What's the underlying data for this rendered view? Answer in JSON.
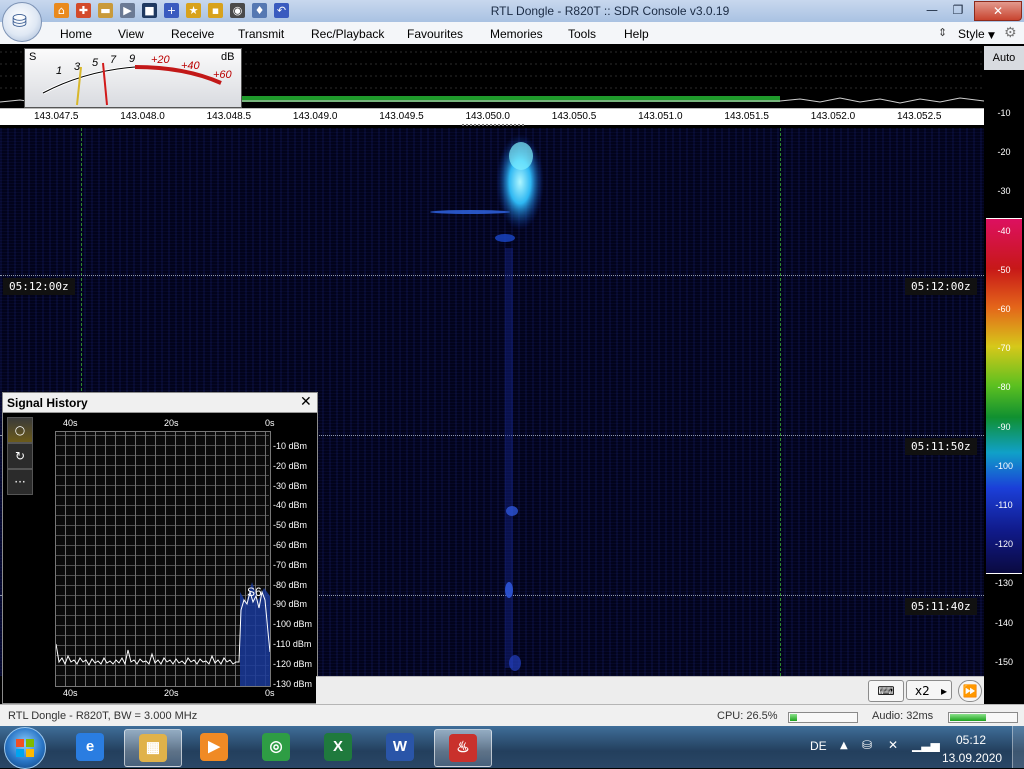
{
  "window": {
    "title": "RTL Dongle - R820T :: SDR Console v3.0.19"
  },
  "titlebar": {
    "minimize": "—",
    "maximize": "❐",
    "close": "✕"
  },
  "quick_access": [
    {
      "icon": "home-icon",
      "glyph": "⌂",
      "color": "#e98a1e"
    },
    {
      "icon": "help-lifebuoy-icon",
      "glyph": "✚",
      "color": "#d34a2a"
    },
    {
      "icon": "folder-icon",
      "glyph": "▬",
      "color": "#c99a3a"
    },
    {
      "icon": "play-icon",
      "glyph": "▶",
      "color": "#6b7a94"
    },
    {
      "icon": "stop-icon",
      "glyph": "■",
      "color": "#1f3960"
    },
    {
      "icon": "add-icon",
      "glyph": "+",
      "color": "#3a5bbf"
    },
    {
      "icon": "star-icon",
      "glyph": "★",
      "color": "#d8a21c"
    },
    {
      "icon": "lock-icon",
      "glyph": "▪",
      "color": "#d8a21c"
    },
    {
      "icon": "camera-icon",
      "glyph": "◉",
      "color": "#4a4a4a"
    },
    {
      "icon": "drop-icon",
      "glyph": "♦",
      "color": "#5578b2"
    },
    {
      "icon": "undo-icon",
      "glyph": "↶",
      "color": "#3a5bbf"
    }
  ],
  "menu": [
    "Home",
    "View",
    "Receive",
    "Transmit",
    "Rec/Playback",
    "Favourites",
    "Memories",
    "Tools",
    "Help"
  ],
  "style_label": "Style",
  "smeter": {
    "s_label": "S",
    "db_label": "dB",
    "s_ticks": [
      "1",
      "3",
      "5",
      "7",
      "9"
    ],
    "db_ticks": [
      "+20",
      "+40",
      "+60"
    ]
  },
  "freq_ticks": [
    "143.047.5",
    "143.048.0",
    "143.048.5",
    "143.049.0",
    "143.049.5",
    "143.050.0",
    "143.050.5",
    "143.051.0",
    "143.051.5",
    "143.052.0",
    "143.052.5"
  ],
  "time_labels": [
    "05:12:00z",
    "05:11:50z",
    "05:11:40z"
  ],
  "right_scale": {
    "auto": "Auto",
    "ticks": [
      "-10",
      "-20",
      "-30",
      "-40",
      "-50",
      "-60",
      "-70",
      "-80",
      "-90",
      "-100",
      "-110",
      "-120",
      "-130",
      "-140",
      "-150"
    ]
  },
  "signal_history": {
    "title": "Signal History",
    "close": "✕",
    "buttons": [
      "○",
      "↻",
      "···"
    ],
    "x_ticks": [
      "40s",
      "20s",
      "0s"
    ],
    "y_ticks": [
      "-10 dBm",
      "-20 dBm",
      "-30 dBm",
      "-40 dBm",
      "-50 dBm",
      "-60 dBm",
      "-70 dBm",
      "-80 dBm",
      "-90 dBm",
      "-100 dBm",
      "-110 dBm",
      "-120 dBm",
      "-130 dBm"
    ],
    "s_reading": "S6"
  },
  "controls": {
    "keyboard": "⌨",
    "zoom": "x2",
    "arrow": "▸",
    "skip": "⏩"
  },
  "status": {
    "device": "RTL Dongle - R820T, BW = 3.000 MHz",
    "cpu": "CPU: 26.5%",
    "cpu_level": 0.1,
    "audio": "Audio: 32ms",
    "audio_level": 0.55
  },
  "taskbar": {
    "apps": [
      {
        "name": "internet-explorer",
        "glyph": "e",
        "color": "#2a7de1"
      },
      {
        "name": "file-explorer",
        "glyph": "▦",
        "color": "#e0b24a"
      },
      {
        "name": "media-player",
        "glyph": "▶",
        "color": "#f08a24"
      },
      {
        "name": "chrome",
        "glyph": "◎",
        "color": "#2e9d44"
      },
      {
        "name": "excel",
        "glyph": "X",
        "color": "#1f7a3d"
      },
      {
        "name": "word",
        "glyph": "W",
        "color": "#2a55a8"
      },
      {
        "name": "sdr-console",
        "glyph": "♨",
        "color": "#c9312c"
      }
    ],
    "language": "DE",
    "time": "05:12",
    "date": "13.09.2020"
  }
}
